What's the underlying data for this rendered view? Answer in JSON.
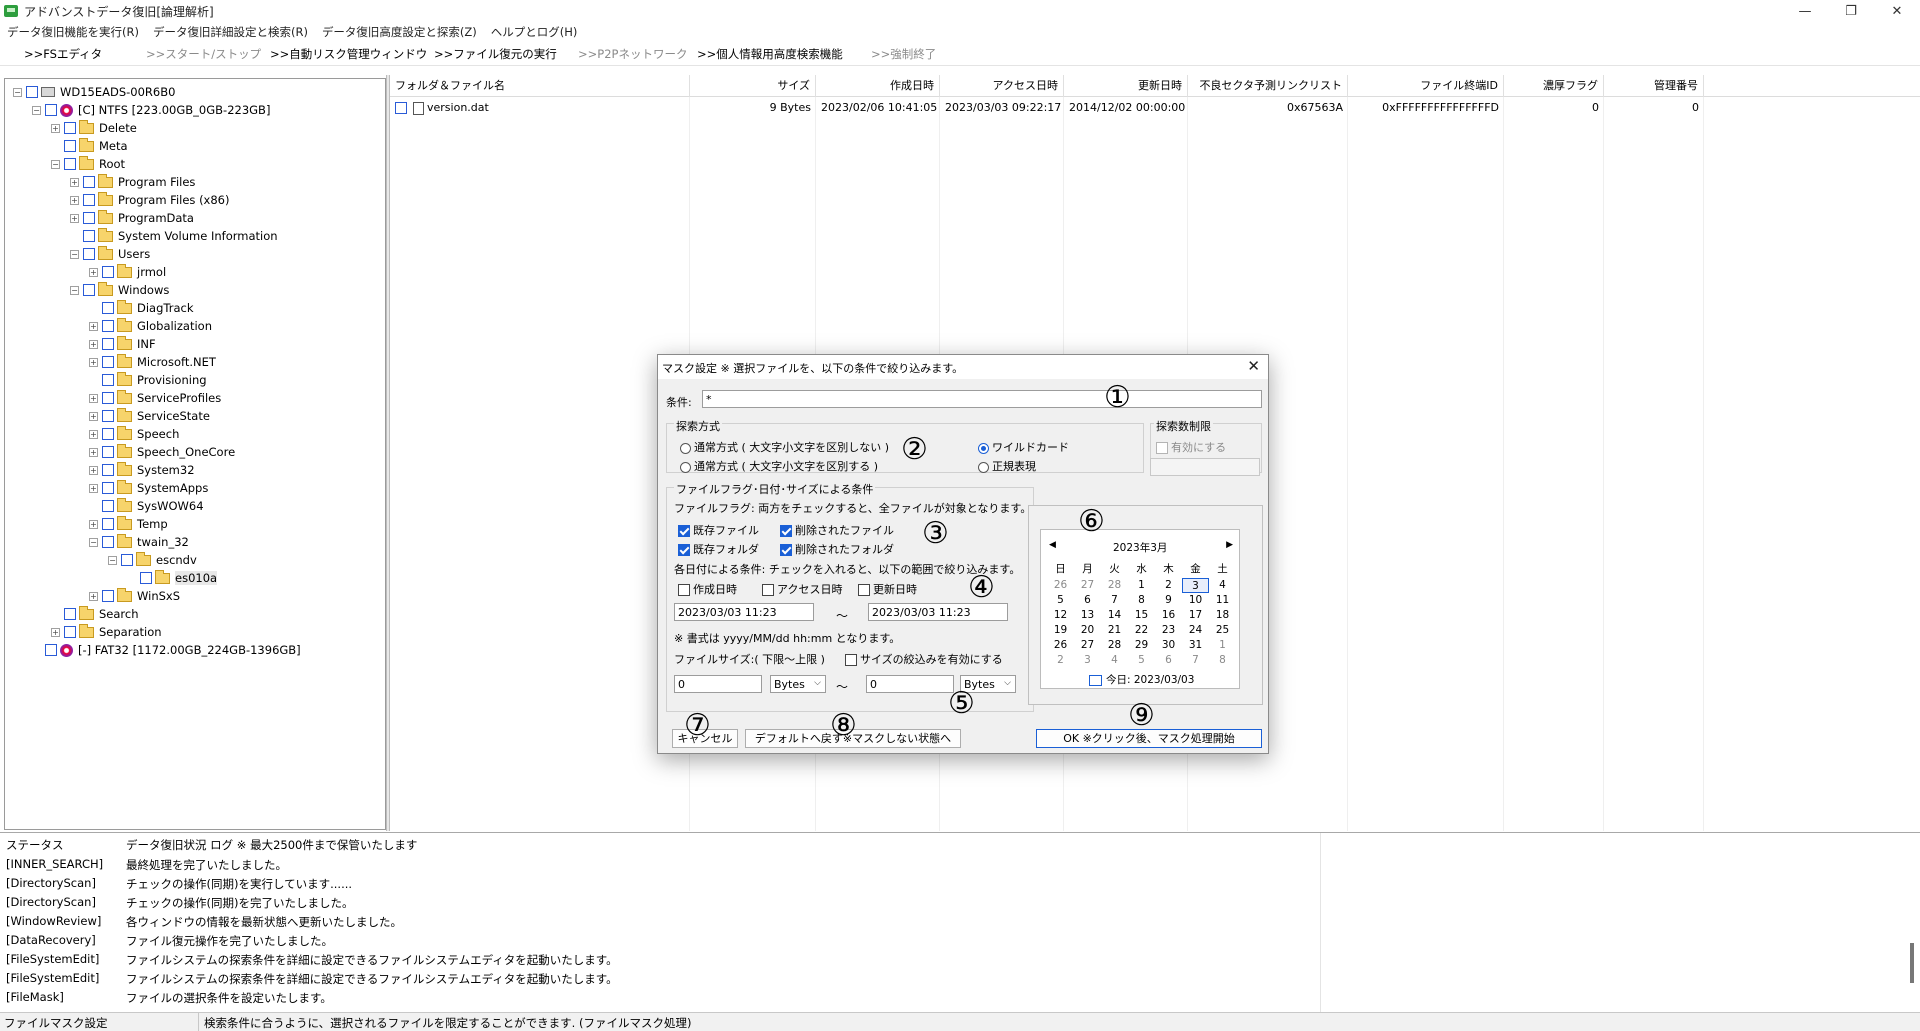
{
  "window": {
    "title": "アドバンストデータ復旧[論理解析]",
    "controls": {
      "minimize": "—",
      "restore": "❐",
      "close": "✕"
    }
  },
  "menu": [
    "データ復旧機能を実行(R)",
    "データ復旧詳細設定と検索(R)",
    "データ復旧高度設定と探索(Z)",
    "ヘルプとログ(H)"
  ],
  "toolbar": [
    {
      "label": ">>FSエディタ",
      "enabled": true
    },
    {
      "label": ">>スタート/ストップ",
      "enabled": false
    },
    {
      "label": ">>自動リスク管理ウィンドウ",
      "enabled": true
    },
    {
      "label": ">>ファイル復元の実行",
      "enabled": true
    },
    {
      "label": ">>P2Pネットワーク",
      "enabled": false
    },
    {
      "label": ">>個人情報用高度検索機能",
      "enabled": true
    },
    {
      "label": ">>強制終了",
      "enabled": false
    }
  ],
  "tree": [
    {
      "label": "WD15EADS-00R6B0",
      "level": 0,
      "expander": "-",
      "icon": "drive"
    },
    {
      "label": "[C] NTFS [223.00GB_0GB-223GB]",
      "level": 1,
      "expander": "-",
      "icon": "disk"
    },
    {
      "label": "Delete",
      "level": 2,
      "expander": "+",
      "icon": "folder"
    },
    {
      "label": "Meta",
      "level": 2,
      "expander": "",
      "icon": "folder"
    },
    {
      "label": "Root",
      "level": 2,
      "expander": "-",
      "icon": "folder"
    },
    {
      "label": "Program Files",
      "level": 3,
      "expander": "+",
      "icon": "folder"
    },
    {
      "label": "Program Files (x86)",
      "level": 3,
      "expander": "+",
      "icon": "folder"
    },
    {
      "label": "ProgramData",
      "level": 3,
      "expander": "+",
      "icon": "folder"
    },
    {
      "label": "System Volume Information",
      "level": 3,
      "expander": "",
      "icon": "folder"
    },
    {
      "label": "Users",
      "level": 3,
      "expander": "-",
      "icon": "folder"
    },
    {
      "label": "jrmol",
      "level": 4,
      "expander": "+",
      "icon": "folder"
    },
    {
      "label": "Windows",
      "level": 3,
      "expander": "-",
      "icon": "folder"
    },
    {
      "label": "DiagTrack",
      "level": 4,
      "expander": "",
      "icon": "folder"
    },
    {
      "label": "Globalization",
      "level": 4,
      "expander": "+",
      "icon": "folder"
    },
    {
      "label": "INF",
      "level": 4,
      "expander": "+",
      "icon": "folder"
    },
    {
      "label": "Microsoft.NET",
      "level": 4,
      "expander": "+",
      "icon": "folder"
    },
    {
      "label": "Provisioning",
      "level": 4,
      "expander": "",
      "icon": "folder"
    },
    {
      "label": "ServiceProfiles",
      "level": 4,
      "expander": "+",
      "icon": "folder"
    },
    {
      "label": "ServiceState",
      "level": 4,
      "expander": "+",
      "icon": "folder"
    },
    {
      "label": "Speech",
      "level": 4,
      "expander": "+",
      "icon": "folder"
    },
    {
      "label": "Speech_OneCore",
      "level": 4,
      "expander": "+",
      "icon": "folder"
    },
    {
      "label": "System32",
      "level": 4,
      "expander": "+",
      "icon": "folder"
    },
    {
      "label": "SystemApps",
      "level": 4,
      "expander": "+",
      "icon": "folder"
    },
    {
      "label": "SysWOW64",
      "level": 4,
      "expander": "",
      "icon": "folder"
    },
    {
      "label": "Temp",
      "level": 4,
      "expander": "+",
      "icon": "folder"
    },
    {
      "label": "twain_32",
      "level": 4,
      "expander": "-",
      "icon": "folder"
    },
    {
      "label": "escndv",
      "level": 5,
      "expander": "-",
      "icon": "folder"
    },
    {
      "label": "es010a",
      "level": 6,
      "expander": "",
      "icon": "folder",
      "selected": true
    },
    {
      "label": "WinSxS",
      "level": 4,
      "expander": "+",
      "icon": "folder"
    },
    {
      "label": "Search",
      "level": 2,
      "expander": "",
      "icon": "folder"
    },
    {
      "label": "Separation",
      "level": 2,
      "expander": "+",
      "icon": "folder"
    },
    {
      "label": "[-] FAT32 [1172.00GB_224GB-1396GB]",
      "level": 1,
      "expander": "",
      "icon": "disk"
    }
  ],
  "file_list": {
    "columns": [
      "フォルダ＆ファイル名",
      "サイズ",
      "作成日時",
      "アクセス日時",
      "更新日時",
      "不良セクタ予測リンクリスト",
      "ファイル終端ID",
      "濃厚フラグ",
      "管理番号"
    ],
    "rows": [
      [
        "version.dat",
        "9 Bytes",
        "2023/02/06 10:41:05",
        "2023/03/03 09:22:17",
        "2014/12/02 00:00:00",
        "0x67563A",
        "0xFFFFFFFFFFFFFFFD",
        "0",
        "0"
      ]
    ]
  },
  "log": {
    "header_status": "ステータス",
    "header_message": "データ復旧状況 ログ ※ 最大2500件まで保管いたします",
    "rows": [
      [
        "[INNER_SEARCH]",
        "最終処理を完了いたしました。"
      ],
      [
        "[DirectoryScan]",
        "チェックの操作(同期)を実行しています......"
      ],
      [
        "[DirectoryScan]",
        "チェックの操作(同期)を完了いたしました。"
      ],
      [
        "[WindowReview]",
        "各ウィンドウの情報を最新状態へ更新いたしました。"
      ],
      [
        "[DataRecovery]",
        "ファイル復元操作を完了いたしました。"
      ],
      [
        "[FileSystemEdit]",
        "ファイルシステムの探索条件を詳細に設定できるファイルシステムエディタを起動いたします。"
      ],
      [
        "[FileSystemEdit]",
        "ファイルシステムの探索条件を詳細に設定できるファイルシステムエディタを起動いたします。"
      ],
      [
        "[FileMask]",
        "ファイルの選択条件を設定いたします。"
      ]
    ]
  },
  "status_bar": {
    "left": "ファイルマスク設定",
    "right": "検索条件に合うように、選択されるファイルを限定することができます. (ファイルマスク処理)"
  },
  "dialog": {
    "title": "マスク設定 ※ 選択ファイルを、以下の条件で絞り込みます。",
    "close": "✕",
    "condition_label": "条件:",
    "condition_value": "*",
    "search_method": {
      "label": "探索方式",
      "normal_insensitive": "通常方式 ( 大文字小文字を区別しない )",
      "normal_sensitive": "通常方式 ( 大文字小文字を区別する )",
      "wildcard": "ワイルドカード",
      "regex": "正規表現"
    },
    "search_limit": {
      "label": "探索数制限",
      "enable": "有効にする",
      "value": ""
    },
    "flags_group_label": "ファイルフラグ･日付･サイズによる条件",
    "flags_note": "ファイルフラグ: 両方をチェックすると、全ファイルが対象となります。",
    "existing_file": "既存ファイル",
    "deleted_file": "削除されたファイル",
    "existing_folder": "既存フォルダ",
    "deleted_folder": "削除されたフォルダ",
    "date_note": "各日付による条件: チェックを入れると、以下の範囲で絞り込みます。",
    "created": "作成日時",
    "accessed": "アクセス日時",
    "modified": "更新日時",
    "date_from": "2023/03/03 11:23",
    "date_to": "2023/03/03 11:23",
    "tilde": "〜",
    "format_note": "※ 書式は yyyy/MM/dd hh:mm となります。",
    "size_label": "ファイルサイズ:( 下限〜上限 )",
    "size_enable": "サイズの絞込みを有効にする",
    "size_from": "0",
    "size_to": "0",
    "unit_from": "Bytes",
    "unit_to": "Bytes",
    "cancel": "キャンセル",
    "default": "デフォルトへ戻す※マスクしない状態へ",
    "ok": "OK ※クリック後、マスク処理開始",
    "badges": [
      "①",
      "②",
      "③",
      "④",
      "⑤",
      "⑥",
      "⑦",
      "⑧",
      "⑨"
    ],
    "calendar": {
      "title": "2023年3月",
      "prev": "◀",
      "next": "▶",
      "weekdays": [
        "日",
        "月",
        "火",
        "水",
        "木",
        "金",
        "土"
      ],
      "days": [
        [
          "26",
          "27",
          "28",
          "1",
          "2",
          "3",
          "4"
        ],
        [
          "5",
          "6",
          "7",
          "8",
          "9",
          "10",
          "11"
        ],
        [
          "12",
          "13",
          "14",
          "15",
          "16",
          "17",
          "18"
        ],
        [
          "19",
          "20",
          "21",
          "22",
          "23",
          "24",
          "25"
        ],
        [
          "26",
          "27",
          "28",
          "29",
          "30",
          "31",
          "1"
        ],
        [
          "2",
          "3",
          "4",
          "5",
          "6",
          "7",
          "8"
        ]
      ],
      "today_label": "今日: 2023/03/03"
    }
  }
}
